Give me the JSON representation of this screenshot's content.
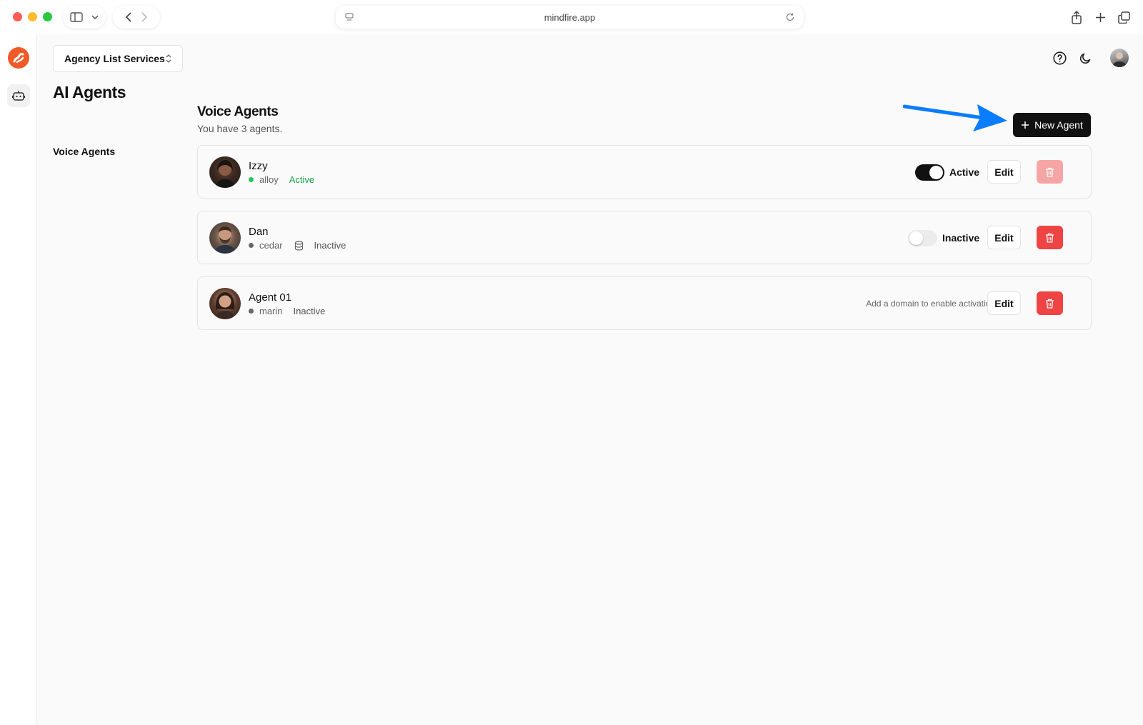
{
  "browser": {
    "url": "mindfire.app"
  },
  "workspace_selector": {
    "label": "Agency List Services"
  },
  "page": {
    "title": "AI Agents",
    "side_nav": [
      "Voice Agents"
    ]
  },
  "section": {
    "title": "Voice Agents",
    "subtitle": "You have 3 agents.",
    "new_button_label": "New Agent"
  },
  "agents": [
    {
      "name": "Izzy",
      "voice": "alloy",
      "status": "Active",
      "toggle_label": "Active",
      "toggle_on": true,
      "edit_label": "Edit"
    },
    {
      "name": "Dan",
      "voice": "cedar",
      "status": "Inactive",
      "toggle_label": "Inactive",
      "toggle_on": false,
      "edit_label": "Edit"
    },
    {
      "name": "Agent 01",
      "voice": "marin",
      "status": "Inactive",
      "hint": "Add a domain to enable activation",
      "edit_label": "Edit"
    }
  ],
  "colors": {
    "brand": "#f05a28",
    "primary_button": "#111111",
    "active_status": "#16a34a",
    "delete": "#ef4444",
    "annotation_arrow": "#0a7cff"
  },
  "icons": [
    "sidebar-toggle-icon",
    "back-icon",
    "forward-icon",
    "reload-icon",
    "share-icon",
    "new-tab-icon",
    "tabs-icon",
    "help-icon",
    "moon-icon",
    "chat-bot-icon",
    "trash-icon",
    "database-icon",
    "plus-icon"
  ]
}
